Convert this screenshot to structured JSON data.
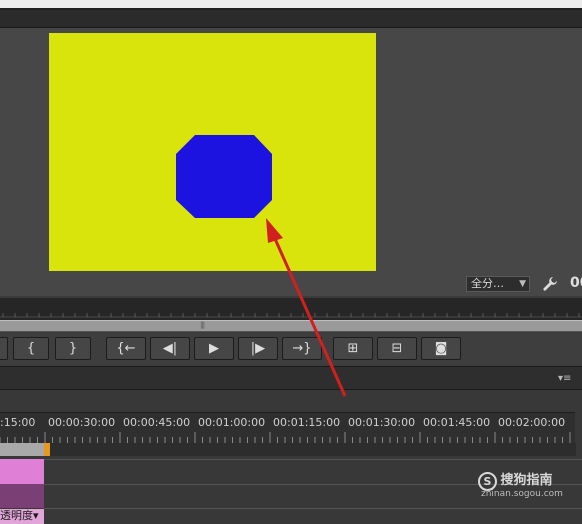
{
  "monitor": {
    "zoom_value": "全分…",
    "timecode": "00",
    "frame_color": "#d8e40c",
    "shape_color": "#1c13e0"
  },
  "transport": {
    "buttons": [
      {
        "icon": "mark-in-icon",
        "glyph": "{"
      },
      {
        "icon": "mark-out-icon",
        "glyph": "}"
      },
      {
        "icon": "go-to-in-icon",
        "glyph": "{←"
      },
      {
        "icon": "step-back-icon",
        "glyph": "◀|"
      },
      {
        "icon": "play-icon",
        "glyph": "▶"
      },
      {
        "icon": "step-forward-icon",
        "glyph": "|▶"
      },
      {
        "icon": "go-to-out-icon",
        "glyph": "→}"
      },
      {
        "icon": "insert-icon",
        "glyph": "⊞"
      },
      {
        "icon": "overwrite-icon",
        "glyph": "⊟"
      },
      {
        "icon": "export-frame-icon",
        "glyph": "◙"
      }
    ]
  },
  "timeline": {
    "ruler_labels": [
      ":15:00",
      "00:00:30:00",
      "00:00:45:00",
      "00:01:00:00",
      "00:01:15:00",
      "00:01:30:00",
      "00:01:45:00",
      "00:02:00:00"
    ],
    "opacity_label": "透明度▾"
  },
  "watermark": {
    "brand": "搜狗指南",
    "url": "zhinan.sogou.com"
  },
  "annotation": {
    "arrow_color": "#d21f1f"
  }
}
